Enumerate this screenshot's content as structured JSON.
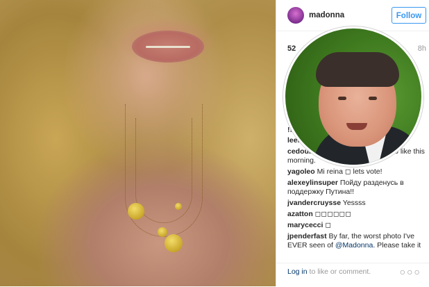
{
  "post": {
    "username": "madonna",
    "follow_label": "Follow",
    "likes_partial": "52",
    "time_ago": "8h"
  },
  "comments": [
    {
      "user": "",
      "text": "!! "
    },
    {
      "user": "leen",
      "text": ""
    },
    {
      "user": "cedoublev",
      "text": "08 I seent but forgot to like this morning."
    },
    {
      "user": "yagoleo",
      "text": "Mi reina ◻ lets vote!"
    },
    {
      "user": "alexeylinsuper",
      "text": "Пойду разденусь в поддержку Путина!!"
    },
    {
      "user": "jvandercruysse",
      "text": "Yessss"
    },
    {
      "user": "azatton",
      "text": "◻◻◻◻◻◻"
    },
    {
      "user": "marycecci",
      "text": "◻"
    },
    {
      "user": "jpenderfast",
      "text": "By far, the worst photo I've EVER seen of",
      "mention": "@Madonna",
      "tail": ". Please take it"
    }
  ],
  "footer": {
    "login_link": "Log in",
    "login_text": " to like or comment.",
    "more": "○○○"
  },
  "colors": {
    "accent": "#3897f0",
    "link": "#003569",
    "muted": "#999999"
  }
}
